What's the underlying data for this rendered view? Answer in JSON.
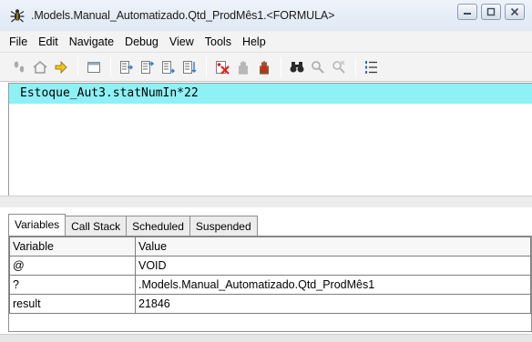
{
  "window": {
    "title": ".Models.Manual_Automatizado.Qtd_ProdMês1.<FORMULA>",
    "icon": "bug-icon"
  },
  "menu": [
    "File",
    "Edit",
    "Navigate",
    "Debug",
    "View",
    "Tools",
    "Help"
  ],
  "toolbar": {
    "groups": [
      [
        "footprints-icon",
        "home-icon",
        "arrow-right-icon"
      ],
      [
        "window-icon"
      ],
      [
        "step-into-icon",
        "step-over-icon",
        "step-out-icon",
        "run-to-cursor-icon"
      ],
      [
        "clear-breakpoints-icon",
        "hand-stop-icon",
        "hand-breakpoint-icon"
      ],
      [
        "binoculars-icon",
        "watch-icon",
        "watch-remove-icon"
      ],
      [
        "numbered-list-icon"
      ]
    ]
  },
  "editor": {
    "formula": "Estoque_Aut3.statNumIn*22",
    "highlight_color": "#8ef1f5"
  },
  "tabs": [
    "Variables",
    "Call Stack",
    "Scheduled",
    "Suspended"
  ],
  "active_tab": "Variables",
  "variables": {
    "columns": [
      "Variable",
      "Value"
    ],
    "rows": [
      {
        "name": "@",
        "value": "VOID"
      },
      {
        "name": "?",
        "value": ".Models.Manual_Automatizado.Qtd_ProdMês1"
      },
      {
        "name": "result",
        "value": "21846"
      }
    ]
  }
}
